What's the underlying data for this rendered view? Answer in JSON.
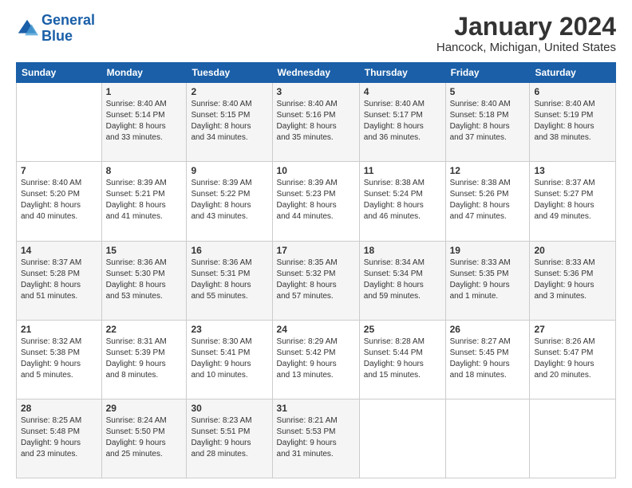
{
  "logo": {
    "text_general": "General",
    "text_blue": "Blue"
  },
  "title": "January 2024",
  "subtitle": "Hancock, Michigan, United States",
  "days_of_week": [
    "Sunday",
    "Monday",
    "Tuesday",
    "Wednesday",
    "Thursday",
    "Friday",
    "Saturday"
  ],
  "weeks": [
    [
      {
        "day": "",
        "sunrise": "",
        "sunset": "",
        "daylight": ""
      },
      {
        "day": "1",
        "sunrise": "Sunrise: 8:40 AM",
        "sunset": "Sunset: 5:14 PM",
        "daylight": "Daylight: 8 hours and 33 minutes."
      },
      {
        "day": "2",
        "sunrise": "Sunrise: 8:40 AM",
        "sunset": "Sunset: 5:15 PM",
        "daylight": "Daylight: 8 hours and 34 minutes."
      },
      {
        "day": "3",
        "sunrise": "Sunrise: 8:40 AM",
        "sunset": "Sunset: 5:16 PM",
        "daylight": "Daylight: 8 hours and 35 minutes."
      },
      {
        "day": "4",
        "sunrise": "Sunrise: 8:40 AM",
        "sunset": "Sunset: 5:17 PM",
        "daylight": "Daylight: 8 hours and 36 minutes."
      },
      {
        "day": "5",
        "sunrise": "Sunrise: 8:40 AM",
        "sunset": "Sunset: 5:18 PM",
        "daylight": "Daylight: 8 hours and 37 minutes."
      },
      {
        "day": "6",
        "sunrise": "Sunrise: 8:40 AM",
        "sunset": "Sunset: 5:19 PM",
        "daylight": "Daylight: 8 hours and 38 minutes."
      }
    ],
    [
      {
        "day": "7",
        "sunrise": "Sunrise: 8:40 AM",
        "sunset": "Sunset: 5:20 PM",
        "daylight": "Daylight: 8 hours and 40 minutes."
      },
      {
        "day": "8",
        "sunrise": "Sunrise: 8:39 AM",
        "sunset": "Sunset: 5:21 PM",
        "daylight": "Daylight: 8 hours and 41 minutes."
      },
      {
        "day": "9",
        "sunrise": "Sunrise: 8:39 AM",
        "sunset": "Sunset: 5:22 PM",
        "daylight": "Daylight: 8 hours and 43 minutes."
      },
      {
        "day": "10",
        "sunrise": "Sunrise: 8:39 AM",
        "sunset": "Sunset: 5:23 PM",
        "daylight": "Daylight: 8 hours and 44 minutes."
      },
      {
        "day": "11",
        "sunrise": "Sunrise: 8:38 AM",
        "sunset": "Sunset: 5:24 PM",
        "daylight": "Daylight: 8 hours and 46 minutes."
      },
      {
        "day": "12",
        "sunrise": "Sunrise: 8:38 AM",
        "sunset": "Sunset: 5:26 PM",
        "daylight": "Daylight: 8 hours and 47 minutes."
      },
      {
        "day": "13",
        "sunrise": "Sunrise: 8:37 AM",
        "sunset": "Sunset: 5:27 PM",
        "daylight": "Daylight: 8 hours and 49 minutes."
      }
    ],
    [
      {
        "day": "14",
        "sunrise": "Sunrise: 8:37 AM",
        "sunset": "Sunset: 5:28 PM",
        "daylight": "Daylight: 8 hours and 51 minutes."
      },
      {
        "day": "15",
        "sunrise": "Sunrise: 8:36 AM",
        "sunset": "Sunset: 5:30 PM",
        "daylight": "Daylight: 8 hours and 53 minutes."
      },
      {
        "day": "16",
        "sunrise": "Sunrise: 8:36 AM",
        "sunset": "Sunset: 5:31 PM",
        "daylight": "Daylight: 8 hours and 55 minutes."
      },
      {
        "day": "17",
        "sunrise": "Sunrise: 8:35 AM",
        "sunset": "Sunset: 5:32 PM",
        "daylight": "Daylight: 8 hours and 57 minutes."
      },
      {
        "day": "18",
        "sunrise": "Sunrise: 8:34 AM",
        "sunset": "Sunset: 5:34 PM",
        "daylight": "Daylight: 8 hours and 59 minutes."
      },
      {
        "day": "19",
        "sunrise": "Sunrise: 8:33 AM",
        "sunset": "Sunset: 5:35 PM",
        "daylight": "Daylight: 9 hours and 1 minute."
      },
      {
        "day": "20",
        "sunrise": "Sunrise: 8:33 AM",
        "sunset": "Sunset: 5:36 PM",
        "daylight": "Daylight: 9 hours and 3 minutes."
      }
    ],
    [
      {
        "day": "21",
        "sunrise": "Sunrise: 8:32 AM",
        "sunset": "Sunset: 5:38 PM",
        "daylight": "Daylight: 9 hours and 5 minutes."
      },
      {
        "day": "22",
        "sunrise": "Sunrise: 8:31 AM",
        "sunset": "Sunset: 5:39 PM",
        "daylight": "Daylight: 9 hours and 8 minutes."
      },
      {
        "day": "23",
        "sunrise": "Sunrise: 8:30 AM",
        "sunset": "Sunset: 5:41 PM",
        "daylight": "Daylight: 9 hours and 10 minutes."
      },
      {
        "day": "24",
        "sunrise": "Sunrise: 8:29 AM",
        "sunset": "Sunset: 5:42 PM",
        "daylight": "Daylight: 9 hours and 13 minutes."
      },
      {
        "day": "25",
        "sunrise": "Sunrise: 8:28 AM",
        "sunset": "Sunset: 5:44 PM",
        "daylight": "Daylight: 9 hours and 15 minutes."
      },
      {
        "day": "26",
        "sunrise": "Sunrise: 8:27 AM",
        "sunset": "Sunset: 5:45 PM",
        "daylight": "Daylight: 9 hours and 18 minutes."
      },
      {
        "day": "27",
        "sunrise": "Sunrise: 8:26 AM",
        "sunset": "Sunset: 5:47 PM",
        "daylight": "Daylight: 9 hours and 20 minutes."
      }
    ],
    [
      {
        "day": "28",
        "sunrise": "Sunrise: 8:25 AM",
        "sunset": "Sunset: 5:48 PM",
        "daylight": "Daylight: 9 hours and 23 minutes."
      },
      {
        "day": "29",
        "sunrise": "Sunrise: 8:24 AM",
        "sunset": "Sunset: 5:50 PM",
        "daylight": "Daylight: 9 hours and 25 minutes."
      },
      {
        "day": "30",
        "sunrise": "Sunrise: 8:23 AM",
        "sunset": "Sunset: 5:51 PM",
        "daylight": "Daylight: 9 hours and 28 minutes."
      },
      {
        "day": "31",
        "sunrise": "Sunrise: 8:21 AM",
        "sunset": "Sunset: 5:53 PM",
        "daylight": "Daylight: 9 hours and 31 minutes."
      },
      {
        "day": "",
        "sunrise": "",
        "sunset": "",
        "daylight": ""
      },
      {
        "day": "",
        "sunrise": "",
        "sunset": "",
        "daylight": ""
      },
      {
        "day": "",
        "sunrise": "",
        "sunset": "",
        "daylight": ""
      }
    ]
  ]
}
